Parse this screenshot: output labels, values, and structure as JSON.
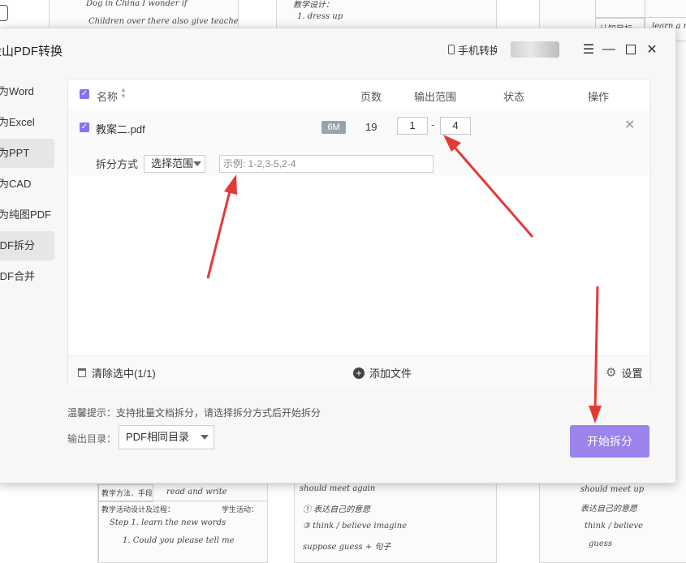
{
  "app": {
    "title": "金山PDF转换"
  },
  "titlebar": {
    "phone_convert": "手机转换"
  },
  "sidebar": {
    "items": [
      {
        "label": "转为Word"
      },
      {
        "label": "转为Excel"
      },
      {
        "label": "转为PPT"
      },
      {
        "label": "转为CAD"
      },
      {
        "label": "转为纯图PDF"
      },
      {
        "label": "PDF拆分"
      },
      {
        "label": "PDF合并"
      }
    ]
  },
  "table": {
    "headers": {
      "name": "名称",
      "pages": "页数",
      "range": "输出范围",
      "status": "状态",
      "action": "操作"
    },
    "rows": [
      {
        "name": "教案二.pdf",
        "size": "6M",
        "pages": "19",
        "range_from": "1",
        "range_to": "4"
      }
    ]
  },
  "split": {
    "label": "拆分方式",
    "mode": "选择范围",
    "placeholder": "示例: 1-2,3-5,2-4"
  },
  "footer": {
    "clear": "清除选中(1/1)",
    "add": "添加文件",
    "settings": "设置"
  },
  "hint": "温馨提示：支持批量文档拆分，请选择拆分方式后开始拆分",
  "output": {
    "label": "输出目录：",
    "value": "PDF相同目录"
  },
  "start_button": "开始拆分",
  "background_notes": {
    "top_left": [
      "Dog in China  I wonder if",
      "Children over there also give teacher"
    ],
    "top_mid": [
      "教学设计：",
      "1. dress up"
    ],
    "top_right": [
      "认知目标",
      "learn a new"
    ],
    "bottom_left": [
      "教学方法、手段",
      "read and write",
      "教学活动设计及过程：",
      "学生活动：",
      "Step 1. learn the new words",
      "1. Could you please tell me"
    ],
    "bottom_mid": [
      "should meet again",
      "① 表达自己的意愿",
      "③ think / believe  imagine",
      "suppose  guess  + 句子"
    ],
    "bottom_right": [
      "should meet up",
      "表达自己的意愿",
      "think / believe",
      "guess"
    ]
  },
  "colors": {
    "accent": "#8c6ff0",
    "start_button": "#9b82ec",
    "arrow": "#e53935"
  }
}
